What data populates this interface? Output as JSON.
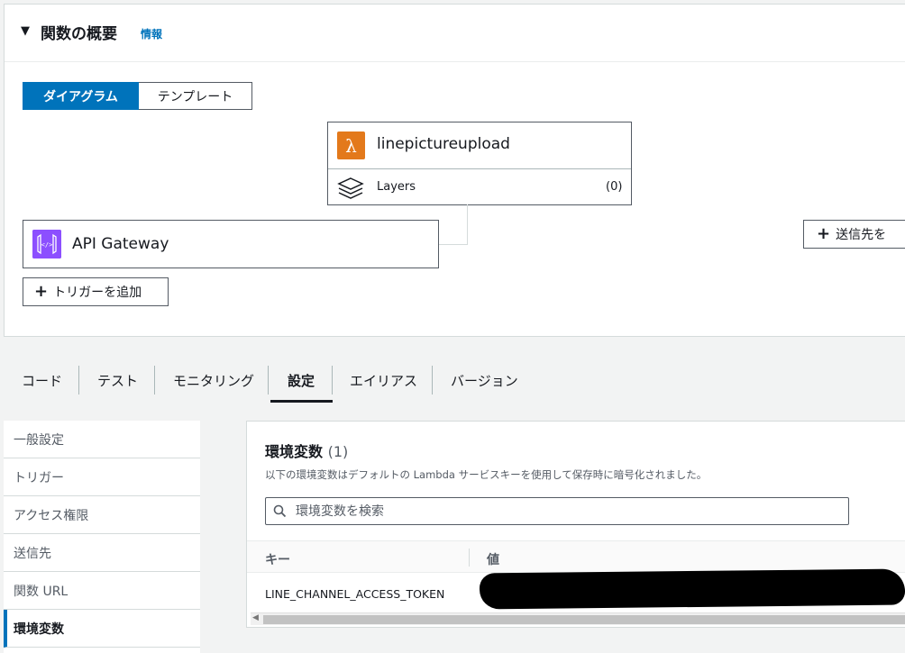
{
  "overview": {
    "title": "関数の概要",
    "info_link": "情報",
    "view_toggle": {
      "diagram": "ダイアグラム",
      "template": "テンプレート"
    },
    "function": {
      "name": "linepictureupload",
      "layers_label": "Layers",
      "layers_count": "(0)"
    },
    "trigger": {
      "name": "API Gateway"
    },
    "add_trigger_label": "トリガーを追加",
    "add_destination_label": "送信先を"
  },
  "tabs": [
    {
      "label": "コード"
    },
    {
      "label": "テスト"
    },
    {
      "label": "モニタリング"
    },
    {
      "label": "設定"
    },
    {
      "label": "エイリアス"
    },
    {
      "label": "バージョン"
    }
  ],
  "active_tab": "設定",
  "config_nav": [
    {
      "label": "一般設定"
    },
    {
      "label": "トリガー"
    },
    {
      "label": "アクセス権限"
    },
    {
      "label": "送信先"
    },
    {
      "label": "関数 URL"
    },
    {
      "label": "環境変数"
    }
  ],
  "env": {
    "title": "環境変数",
    "count": "(1)",
    "description": "以下の環境変数はデフォルトの Lambda サービスキーを使用して保存時に暗号化されました。",
    "search_placeholder": "環境変数を検索",
    "col_key": "キー",
    "col_value": "値",
    "rows": [
      {
        "key": "LINE_CHANNEL_ACCESS_TOKEN"
      }
    ]
  },
  "colors": {
    "accent": "#0073bb",
    "lambda_orange": "#e3791b",
    "apigw_purple": "#8c4fff"
  },
  "icons": [
    "caret-down-icon",
    "lambda-icon",
    "layers-icon",
    "api-gateway-icon",
    "plus-icon",
    "search-icon"
  ]
}
